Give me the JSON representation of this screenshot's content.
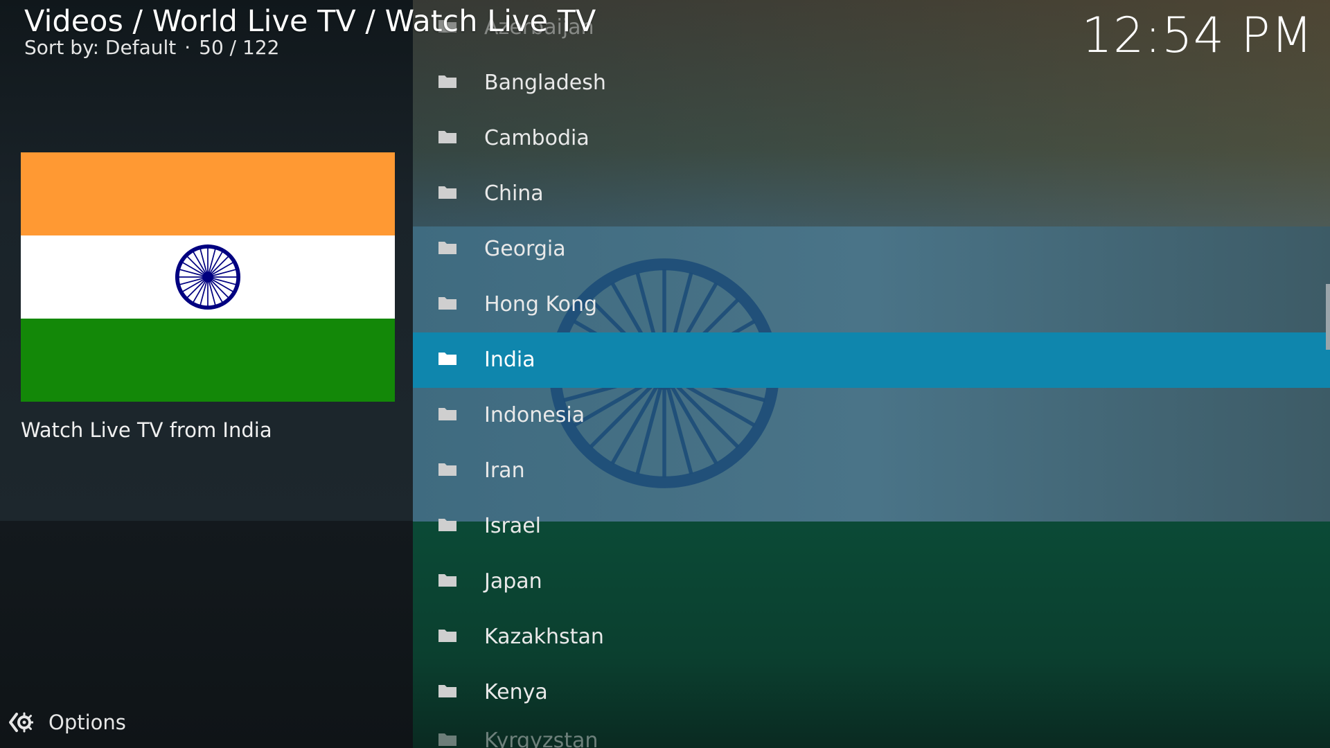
{
  "header": {
    "breadcrumb": "Videos / World Live TV / Watch Live TV",
    "sort_label": "Sort by: Default",
    "separator": "·",
    "position": "50 / 122",
    "clock": "12:54 PM"
  },
  "info_panel": {
    "plot": "Watch Live TV from India",
    "flag_colors": {
      "saffron": "#FF9933",
      "white": "#FFFFFF",
      "green": "#138808",
      "chakra": "#000080"
    }
  },
  "list": {
    "items": [
      {
        "label": "Azerbaijan",
        "icon": "folder-icon"
      },
      {
        "label": "Bangladesh",
        "icon": "folder-icon"
      },
      {
        "label": "Cambodia",
        "icon": "folder-icon"
      },
      {
        "label": "China",
        "icon": "folder-icon"
      },
      {
        "label": "Georgia",
        "icon": "folder-icon"
      },
      {
        "label": "Hong Kong",
        "icon": "folder-icon"
      },
      {
        "label": "India",
        "icon": "folder-icon",
        "selected": true
      },
      {
        "label": "Indonesia",
        "icon": "folder-icon"
      },
      {
        "label": "Iran",
        "icon": "folder-icon"
      },
      {
        "label": "Israel",
        "icon": "folder-icon"
      },
      {
        "label": "Japan",
        "icon": "folder-icon"
      },
      {
        "label": "Kazakhstan",
        "icon": "folder-icon"
      },
      {
        "label": "Kenya",
        "icon": "folder-icon"
      },
      {
        "label": "Kyrgyzstan",
        "icon": "folder-icon"
      }
    ],
    "selected_color": "#0F86AD"
  },
  "footer": {
    "options_label": "Options",
    "options_icon": "options-gear-icon"
  }
}
